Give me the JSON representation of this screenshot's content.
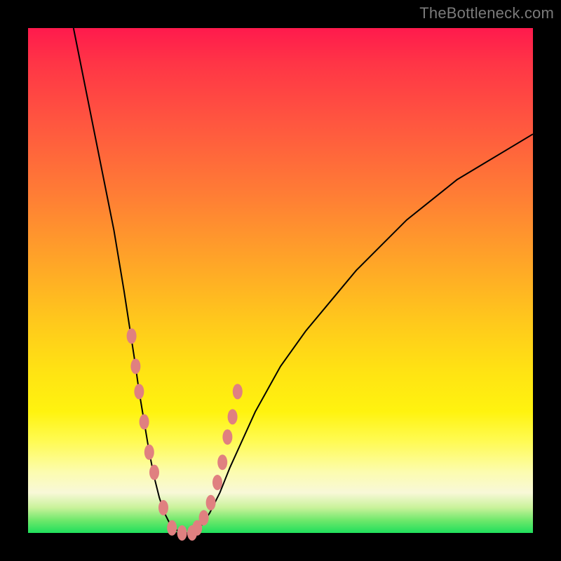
{
  "watermark": "TheBottleneck.com",
  "colors": {
    "frame": "#000000",
    "marker": "#e08080",
    "curve": "#000000",
    "gradient_stops": [
      {
        "pct": 0,
        "hex": "#ff1a4d"
      },
      {
        "pct": 7,
        "hex": "#ff3546"
      },
      {
        "pct": 18,
        "hex": "#ff5440"
      },
      {
        "pct": 33,
        "hex": "#ff7d35"
      },
      {
        "pct": 46,
        "hex": "#ffa428"
      },
      {
        "pct": 58,
        "hex": "#ffc81c"
      },
      {
        "pct": 68,
        "hex": "#ffe313"
      },
      {
        "pct": 76,
        "hex": "#fff30f"
      },
      {
        "pct": 82,
        "hex": "#fffb55"
      },
      {
        "pct": 88,
        "hex": "#fcfcb0"
      },
      {
        "pct": 92,
        "hex": "#f8f8d8"
      },
      {
        "pct": 95,
        "hex": "#c9f29a"
      },
      {
        "pct": 97.5,
        "hex": "#6fe86b"
      },
      {
        "pct": 100,
        "hex": "#1fdf5c"
      }
    ]
  },
  "chart_data": {
    "type": "line",
    "title": "",
    "xlabel": "",
    "ylabel": "",
    "xlim": [
      0,
      100
    ],
    "ylim": [
      0,
      100
    ],
    "series": [
      {
        "name": "bottleneck-curve",
        "x": [
          9,
          11,
          13,
          15,
          17,
          19,
          21,
          22,
          23,
          24,
          25,
          26,
          27,
          28,
          29,
          30,
          31,
          32,
          33,
          34,
          36,
          38,
          40,
          45,
          50,
          55,
          60,
          65,
          70,
          75,
          80,
          85,
          90,
          95,
          100
        ],
        "y": [
          100,
          90,
          80,
          70,
          60,
          48,
          35,
          28,
          22,
          16,
          11,
          7,
          4,
          2,
          1,
          0,
          0,
          0,
          0,
          1,
          4,
          8,
          13,
          24,
          33,
          40,
          46,
          52,
          57,
          62,
          66,
          70,
          73,
          76,
          79
        ]
      }
    ],
    "markers": {
      "name": "marker-dots",
      "x": [
        20.5,
        21.3,
        22.0,
        23.0,
        24.0,
        25.0,
        26.8,
        28.5,
        30.5,
        32.5,
        33.5,
        34.8,
        36.2,
        37.5,
        38.5,
        39.5,
        40.5,
        41.5
      ],
      "y": [
        39,
        33,
        28,
        22,
        16,
        12,
        5,
        1,
        0,
        0,
        1,
        3,
        6,
        10,
        14,
        19,
        23,
        28
      ]
    },
    "floor": {
      "x": [
        28.5,
        33.5
      ],
      "y": 0
    }
  }
}
